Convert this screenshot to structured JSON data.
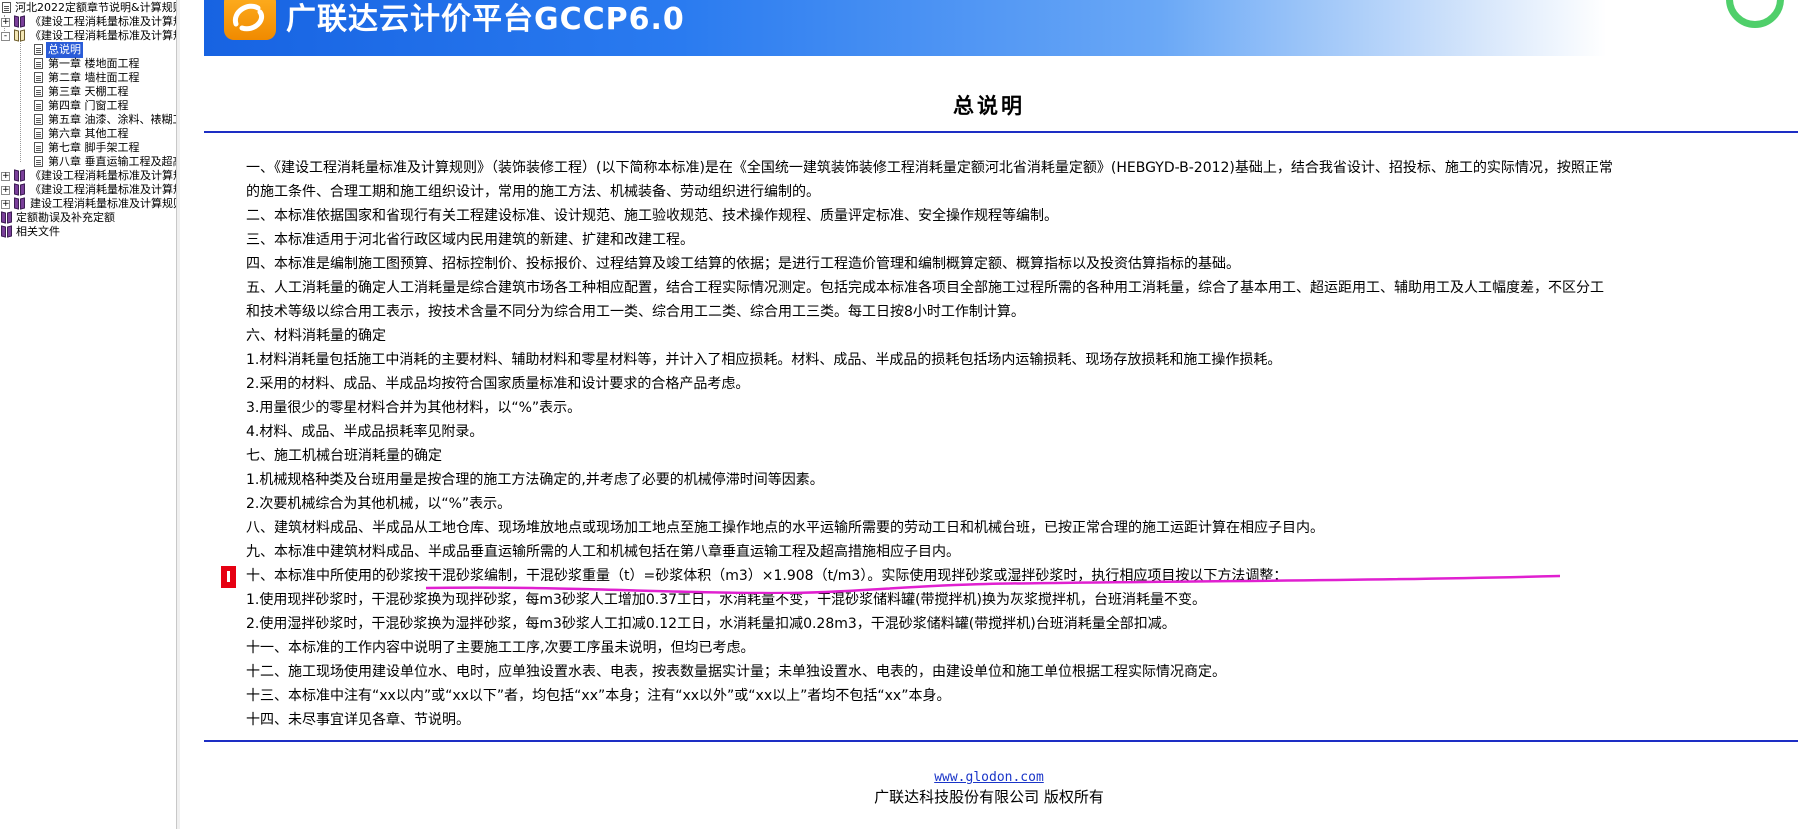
{
  "tree": {
    "items": [
      {
        "label": "河北2022定额章节说明&计算规则",
        "level": 0,
        "icon": "page-icon",
        "expander": ""
      },
      {
        "label": "《建设工程消耗量标准及计算规则》",
        "level": 0,
        "icon": "book-icon",
        "expander": "+"
      },
      {
        "label": "《建设工程消耗量标准及计算规则》",
        "level": 0,
        "icon": "book-open-icon",
        "expander": "-"
      },
      {
        "label": "总说明",
        "level": 1,
        "icon": "page-icon",
        "expander": "",
        "selected": true
      },
      {
        "label": "第一章 楼地面工程",
        "level": 1,
        "icon": "page-icon",
        "expander": ""
      },
      {
        "label": "第二章 墙柱面工程",
        "level": 1,
        "icon": "page-icon",
        "expander": ""
      },
      {
        "label": "第三章 天棚工程",
        "level": 1,
        "icon": "page-icon",
        "expander": ""
      },
      {
        "label": "第四章 门窗工程",
        "level": 1,
        "icon": "page-icon",
        "expander": ""
      },
      {
        "label": "第五章 油漆、涂料、裱糊工程",
        "level": 1,
        "icon": "page-icon",
        "expander": ""
      },
      {
        "label": "第六章 其他工程",
        "level": 1,
        "icon": "page-icon",
        "expander": ""
      },
      {
        "label": "第七章 脚手架工程",
        "level": 1,
        "icon": "page-icon",
        "expander": ""
      },
      {
        "label": "第八章 垂直运输工程及超高",
        "level": 1,
        "icon": "page-icon",
        "expander": ""
      },
      {
        "label": "《建设工程消耗量标准及计算规则》",
        "level": 0,
        "icon": "book-icon",
        "expander": "+"
      },
      {
        "label": "《建设工程消耗量标准及计算规则》",
        "level": 0,
        "icon": "book-icon",
        "expander": "+"
      },
      {
        "label": "建设工程消耗量标准及计算规则",
        "level": 0,
        "icon": "book-icon",
        "expander": "+"
      },
      {
        "label": "定额勘误及补充定额",
        "level": 0,
        "icon": "book-icon",
        "expander": ""
      },
      {
        "label": "相关文件",
        "level": 0,
        "icon": "book-icon",
        "expander": ""
      }
    ]
  },
  "banner": {
    "title": "广联达云计价平台GCCP6.0"
  },
  "document": {
    "title": "总说明",
    "lines": [
      "一、《建设工程消耗量标准及计算规则》（装饰装修工程）(以下简称本标准)是在《全国统一建筑装饰装修工程消耗量定额河北省消耗量定额》(HEBGYD-B-2012)基础上，结合我省设计、招投标、施工的实际情况，按照正常",
      "的施工条件、合理工期和施工组织设计，常用的施工方法、机械装备、劳动组织进行编制的。",
      "二、本标准依据国家和省现行有关工程建设标准、设计规范、施工验收规范、技术操作规程、质量评定标准、安全操作规程等编制。",
      "三、本标准适用于河北省行政区域内民用建筑的新建、扩建和改建工程。",
      "四、本标准是编制施工图预算、招标控制价、投标报价、过程结算及竣工结算的依据；是进行工程造价管理和编制概算定额、概算指标以及投资估算指标的基础。",
      "五、人工消耗量的确定人工消耗量是综合建筑市场各工种相应配置，结合工程实际情况测定。包括完成本标准各项目全部施工过程所需的各种用工消耗量，综合了基本用工、超运距用工、辅助用工及人工幅度差，不区分工",
      "和技术等级以综合用工表示，按技术含量不同分为综合用工一类、综合用工二类、综合用工三类。每工日按8小时工作制计算。",
      "六、材料消耗量的确定",
      "1.材料消耗量包括施工中消耗的主要材料、辅助材料和零星材料等，并计入了相应损耗。材料、成品、半成品的损耗包括场内运输损耗、现场存放损耗和施工操作损耗。",
      "2.采用的材料、成品、半成品均按符合国家质量标准和设计要求的合格产品考虑。",
      "3.用量很少的零星材料合并为其他材料，以“%”表示。",
      "4.材料、成品、半成品损耗率见附录。",
      "七、施工机械台班消耗量的确定",
      "1.机械规格种类及台班用量是按合理的施工方法确定的,并考虑了必要的机械停滞时间等因素。",
      "2.次要机械综合为其他机械，以“%”表示。",
      "八、建筑材料成品、半成品从工地仓库、现场堆放地点或现场加工地点至施工操作地点的水平运输所需要的劳动工日和机械台班，已按正常合理的施工运距计算在相应子目内。",
      "九、本标准中建筑材料成品、半成品垂直运输所需的人工和机械包括在第八章垂直运输工程及超高措施相应子目内。",
      "十、本标准中所使用的砂浆按干混砂浆编制，干混砂浆重量（t）=砂浆体积（m3）×1.908（t/m3）。实际使用现拌砂浆或湿拌砂浆时，执行相应项目按以下方法调整：",
      "1.使用现拌砂浆时，干混砂浆换为现拌砂浆，每m3砂浆人工增加0.37工日，水消耗量不变，干混砂浆储料罐(带搅拌机)换为灰浆搅拌机，台班消耗量不变。",
      "2.使用湿拌砂浆时，干混砂浆换为湿拌砂浆，每m3砂浆人工扣减0.12工日，水消耗量扣减0.28m3，干混砂浆储料罐(带搅拌机)台班消耗量全部扣减。",
      "十一、本标准的工作内容中说明了主要施工工序,次要工序虽未说明，但均已考虑。",
      "十二、施工现场使用建设单位水、电时，应单独设置水表、电表，按表数量据实计量；未单独设置水、电表的，由建设单位和施工单位根据工程实际情况商定。",
      "十三、本标准中注有“xx以内”或“xx以下”者，均包括“xx”本身；注有“xx以外”或“xx以上”者均不包括“xx”本身。",
      "十四、未尽事宜详见各章、节说明。"
    ]
  },
  "footer": {
    "link": "www.glodon.com",
    "copyright": "广联达科技股份有限公司 版权所有"
  },
  "colors": {
    "banner_blue": "#1763e2",
    "rule_blue": "#1d2ec4",
    "marker_red": "#e60012",
    "annotation_magenta": "#e020d0",
    "logo_orange": "#f39800",
    "selection_blue": "#2a5cd8"
  }
}
